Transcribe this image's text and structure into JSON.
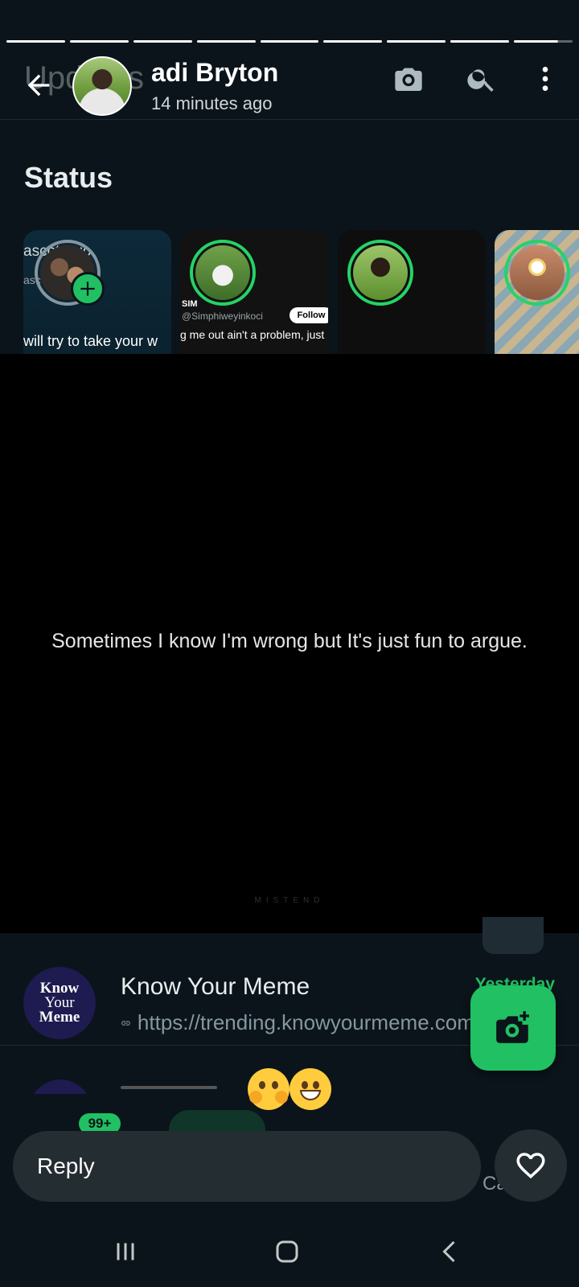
{
  "progress": {
    "segments": 9,
    "current_fill": 0.75
  },
  "header": {
    "ghost_title": "Updates",
    "contact_name": "adi Bryton",
    "time_ago": "14 minutes ago",
    "icons": [
      "back-arrow-icon",
      "camera-icon",
      "search-icon",
      "more-vertical-icon"
    ]
  },
  "status": {
    "title": "Status",
    "cards": [
      {
        "top_text": "ascotwaio",
        "sub_text": "asc",
        "caption": "will try to take your w"
      },
      {
        "handle_name": "SIM",
        "handle": "@Simphiweyinkoci",
        "follow": "Follow",
        "caption": "g me out ain't a problem, just"
      },
      {
        "caption": ""
      },
      {
        "caption": ""
      }
    ]
  },
  "viewer": {
    "text": "Sometimes I know I'm wrong but It's just fun to argue.",
    "watermark": "MISTEND"
  },
  "chat": {
    "avatar_lines": [
      "Know",
      "Your",
      "Meme"
    ],
    "name": "Know Your Meme",
    "date": "Yesterday",
    "preview": "https://trending.knowyourmeme.com"
  },
  "nav": {
    "badge": "99+",
    "calls_fragment": "Ca"
  },
  "reply": {
    "placeholder": "Reply"
  },
  "colors": {
    "accent": "#21c063",
    "background": "#0b141a",
    "viewer": "#000000"
  }
}
